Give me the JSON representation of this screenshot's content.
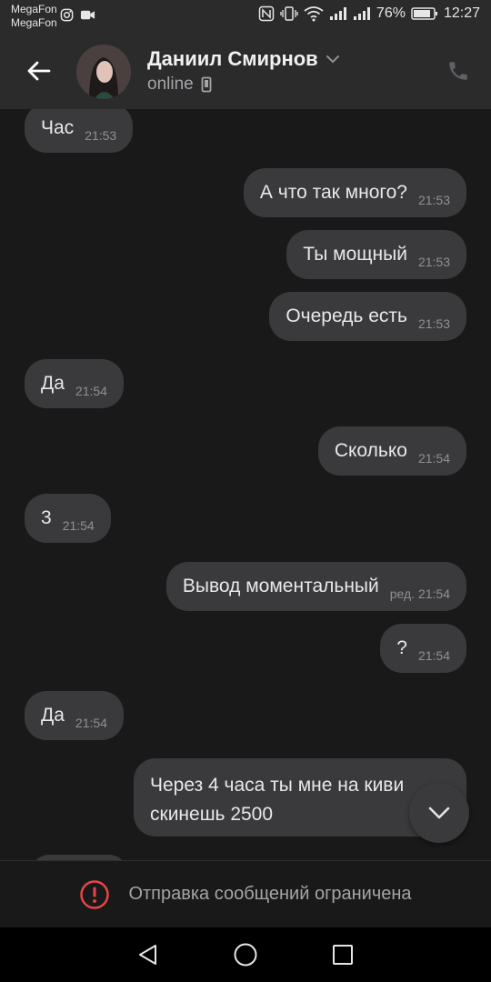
{
  "status_bar": {
    "carrier1": "MegaFon",
    "carrier2": "MegaFon",
    "battery": "76%",
    "time": "12:27"
  },
  "header": {
    "name": "Даниил Смирнов",
    "status": "online"
  },
  "messages": [
    {
      "dir": "in",
      "text": "Час",
      "time": "21:53"
    },
    {
      "dir": "out",
      "text": "А что так много?",
      "time": "21:53"
    },
    {
      "dir": "out",
      "text": "Ты мощный",
      "time": "21:53"
    },
    {
      "dir": "out",
      "text": "Очередь есть",
      "time": "21:53"
    },
    {
      "dir": "in",
      "text": "Да",
      "time": "21:54"
    },
    {
      "dir": "out",
      "text": "Сколько",
      "time": "21:54"
    },
    {
      "dir": "in",
      "text": "3",
      "time": "21:54"
    },
    {
      "dir": "out",
      "text": "Вывод моментальный",
      "time": "ред. 21:54"
    },
    {
      "dir": "out",
      "text": "?",
      "time": "21:54"
    },
    {
      "dir": "in",
      "text": "Да",
      "time": "21:54"
    },
    {
      "dir": "out",
      "text": "Через 4 часа ты мне на киви скинешь 2500",
      "time": ""
    }
  ],
  "restriction": {
    "text": "Отправка сообщений ограничена"
  },
  "colors": {
    "background": "#19191a",
    "bubble": "#3a3a3c",
    "header": "#2b2b2c",
    "warning": "#e64646"
  }
}
